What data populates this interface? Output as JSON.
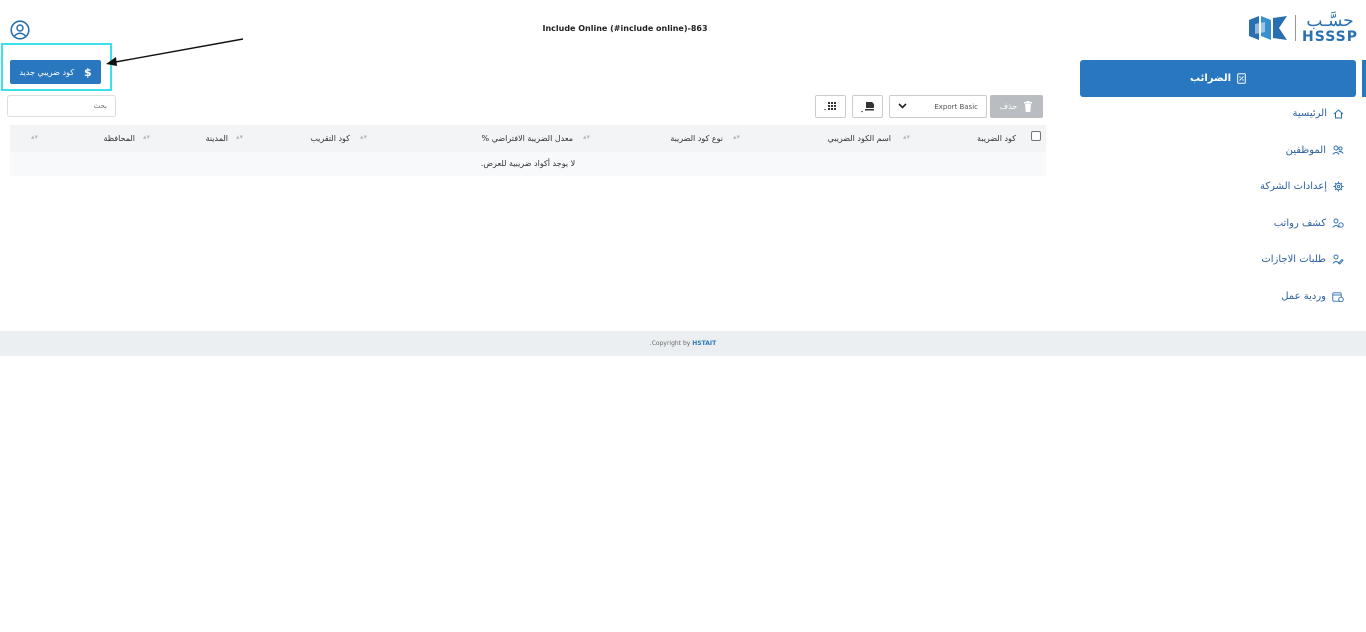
{
  "header": {
    "title": "Include Online (#include online)-863"
  },
  "logo": {
    "arabic": "حسَّـب",
    "english": "HSSSP"
  },
  "actions": {
    "new_button_label": "كود ضريبي جديد",
    "new_button_icon": "$"
  },
  "search": {
    "placeholder": "بحث"
  },
  "toolbar": {
    "delete_label": "حذف",
    "export_label": "Export Basic"
  },
  "table": {
    "columns": [
      "كود الضريبة",
      "اسم الكود الضريبي",
      "نوع كود الضريبة",
      "معدل الضريبة الافتراضي %",
      "كود التقريب",
      "المدينة",
      "المحافظة"
    ],
    "empty_message": "لا يوجد أكواد ضريبية للعرض."
  },
  "sidebar": {
    "active": "الضرائب",
    "items": [
      {
        "label": "الرئيسية",
        "icon": "home-icon"
      },
      {
        "label": "الموظفين",
        "icon": "users-icon"
      },
      {
        "label": "إعدادات الشركة",
        "icon": "gear-icon"
      },
      {
        "label": "كشف رواتب",
        "icon": "payroll-icon"
      },
      {
        "label": "طلبات الاجازات",
        "icon": "leave-icon"
      },
      {
        "label": "وردية عمل",
        "icon": "shift-icon"
      }
    ]
  },
  "footer": {
    "prefix": "Copyright by",
    "brand": "HSTAIT",
    "suffix": "."
  },
  "colors": {
    "primary": "#2977bf",
    "highlight": "#3be1ea",
    "footer_bg": "#eceff1"
  }
}
